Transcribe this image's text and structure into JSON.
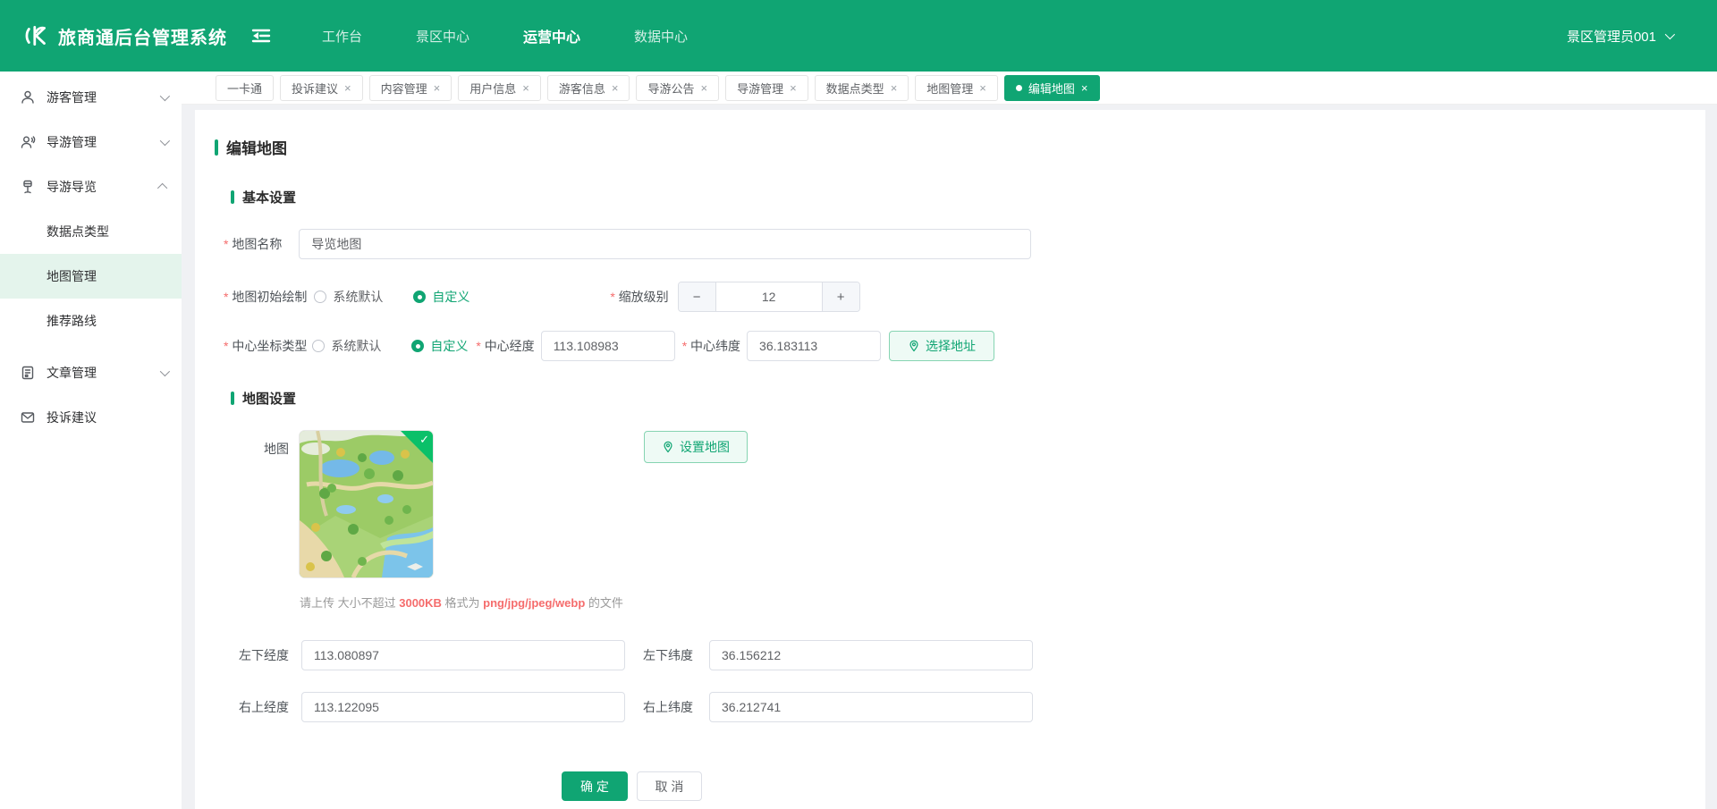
{
  "colors": {
    "primary": "#10A573",
    "badge_check": "#0BC069",
    "danger": "#F56C6C",
    "sidebar_active_bg": "#E4F4EC",
    "button_light_bg": "#EEFAF5"
  },
  "navbar": {
    "brand": "旅商通后台管理系统",
    "menu": [
      {
        "label": "工作台",
        "active": false
      },
      {
        "label": "景区中心",
        "active": false
      },
      {
        "label": "运营中心",
        "active": true
      },
      {
        "label": "数据中心",
        "active": false
      }
    ],
    "user": "景区管理员001"
  },
  "tabs": [
    {
      "label": "一卡通",
      "closable": false,
      "active": false
    },
    {
      "label": "投诉建议",
      "close": "×",
      "active": false
    },
    {
      "label": "内容管理",
      "close": "×",
      "active": false
    },
    {
      "label": "用户信息",
      "close": "×",
      "active": false
    },
    {
      "label": "游客信息",
      "close": "×",
      "active": false
    },
    {
      "label": "导游公告",
      "close": "×",
      "active": false
    },
    {
      "label": "导游管理",
      "close": "×",
      "active": false
    },
    {
      "label": "数据点类型",
      "close": "×",
      "active": false
    },
    {
      "label": "地图管理",
      "close": "×",
      "active": false
    },
    {
      "label": "编辑地图",
      "close": "×",
      "active": true
    }
  ],
  "sidebar": {
    "items": [
      {
        "label": "游客管理",
        "icon": "visitor-icon",
        "expand": "down"
      },
      {
        "label": "导游管理",
        "icon": "guide-icon",
        "expand": "down"
      },
      {
        "label": "导游导览",
        "icon": "signpost-icon",
        "expand": "up",
        "children": [
          {
            "label": "数据点类型",
            "active": false
          },
          {
            "label": "地图管理",
            "active": true
          },
          {
            "label": "推荐路线",
            "active": false
          }
        ]
      },
      {
        "label": "文章管理",
        "icon": "article-icon",
        "expand": "down"
      },
      {
        "label": "投诉建议",
        "icon": "mail-icon"
      }
    ]
  },
  "page": {
    "title": "编辑地图",
    "section_basic": "基本设置",
    "section_map": "地图设置",
    "fields": {
      "map_name": {
        "label": "地图名称",
        "value": "导览地图"
      },
      "initial_draw": {
        "label": "地图初始绘制",
        "option_default": "系统默认",
        "option_custom": "自定义",
        "selected": "自定义"
      },
      "zoom_level": {
        "label": "缩放级别",
        "value": "12",
        "decrease": "−",
        "increase": "+"
      },
      "center_type": {
        "label": "中心坐标类型",
        "option_default": "系统默认",
        "option_custom": "自定义",
        "selected": "自定义"
      },
      "center_lng": {
        "label": "中心经度",
        "value": "113.108983"
      },
      "center_lat": {
        "label": "中心纬度",
        "value": "36.183113"
      },
      "choose_address": "选择地址",
      "map_image": {
        "label": "地图"
      },
      "set_map": "设置地图",
      "upload_hint": {
        "part1": "请上传 大小不超过 ",
        "size": "3000KB",
        "part2": " 格式为 ",
        "formats": "png/jpg/jpeg/webp",
        "part3": " 的文件"
      },
      "bl_lng": {
        "label": "左下经度",
        "value": "113.080897"
      },
      "bl_lat": {
        "label": "左下纬度",
        "value": "36.156212"
      },
      "tr_lng": {
        "label": "右上经度",
        "value": "113.122095"
      },
      "tr_lat": {
        "label": "右上纬度",
        "value": "36.212741"
      }
    },
    "actions": {
      "confirm": "确 定",
      "cancel": "取 消"
    }
  }
}
